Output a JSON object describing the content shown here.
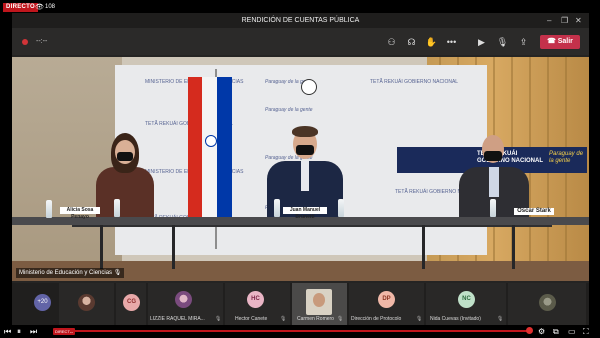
{
  "broadcast": {
    "live_label": "DIRECTO",
    "viewers": "108"
  },
  "window": {
    "title": "RENDICIÓN DE CUENTAS PÚBLICA",
    "timer": "--:--",
    "leave_label": "Salir"
  },
  "video": {
    "source_label": "Ministerio de Educación y Ciencias",
    "nameplates": [
      "Alicia Sosa Penayo",
      "Juan Manuel Brunetti",
      "Oscar Stark"
    ],
    "banner_text": [
      "Paraguay de la gente",
      "TETÃ REKUÁI GOBIERNO NACIONAL",
      "MINISTERIO DE EDUCACIÓN Y CIENCIAS"
    ],
    "screen_title": "TETÃ REKUÁI GOBIERNO NACIONAL",
    "screen_slogan": "Paraguay de la gente"
  },
  "participants": {
    "overflow_count": "+20",
    "tiles": [
      {
        "initials": "",
        "name": "",
        "type": "photo"
      },
      {
        "initials": "CG",
        "name": "",
        "type": "avatar",
        "color": "#e8a9a9",
        "text_color": "#8b2b2b"
      },
      {
        "initials": "",
        "name": "LIZZIE RAQUEL MIRA...",
        "type": "photo"
      },
      {
        "initials": "HC",
        "name": "Hector Canete",
        "type": "avatar",
        "color": "#e9b5c5",
        "text_color": "#7b2446"
      },
      {
        "initials": "",
        "name": "Carmen Romero",
        "type": "video"
      },
      {
        "initials": "DP",
        "name": "Dirección de Protocolo",
        "type": "avatar",
        "color": "#f0b8a8",
        "text_color": "#8a3422"
      },
      {
        "initials": "NC",
        "name": "Nida Cuevas (Invitado)",
        "type": "avatar",
        "color": "#bfe0c8",
        "text_color": "#2c6a3e"
      },
      {
        "initials": "",
        "name": "",
        "type": "photo"
      }
    ]
  },
  "icons": {
    "toolbar": [
      "participants-icon",
      "chat-icon",
      "reactions-icon",
      "more-icon",
      "camera-off-icon",
      "mic-off-icon",
      "share-icon"
    ],
    "player": [
      "prev-icon",
      "pause-icon",
      "next-icon",
      "volume-icon",
      "settings-icon",
      "miniplayer-icon",
      "theater-icon",
      "fullscreen-icon"
    ]
  },
  "colors": {
    "leave_button": "#c4314b",
    "live_badge": "#c0161d",
    "teams_purple": "#6264a7"
  }
}
